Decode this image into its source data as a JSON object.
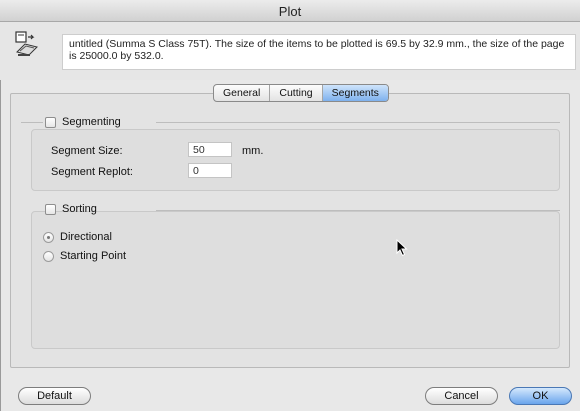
{
  "window": {
    "title": "Plot"
  },
  "header": {
    "info_text": "untitled (Summa S Class 75T). The size of the items to be plotted is 69.5 by 32.9 mm., the size of the page is 25000.0 by 532.0."
  },
  "tabs": [
    {
      "label": "General",
      "active": false
    },
    {
      "label": "Cutting",
      "active": false
    },
    {
      "label": "Segments",
      "active": true
    }
  ],
  "segmenting": {
    "label": "Segmenting",
    "checked": false,
    "segment_size_label": "Segment Size:",
    "segment_size_value": "50",
    "segment_size_unit": "mm.",
    "segment_replot_label": "Segment Replot:",
    "segment_replot_value": "0"
  },
  "sorting": {
    "label": "Sorting",
    "checked": false,
    "options": [
      {
        "label": "Directional",
        "selected": true
      },
      {
        "label": "Starting Point",
        "selected": false
      }
    ]
  },
  "buttons": {
    "default": "Default",
    "cancel": "Cancel",
    "ok": "OK"
  },
  "colors": {
    "accent": "#6aa5ec",
    "panel": "#e3e3e3"
  }
}
